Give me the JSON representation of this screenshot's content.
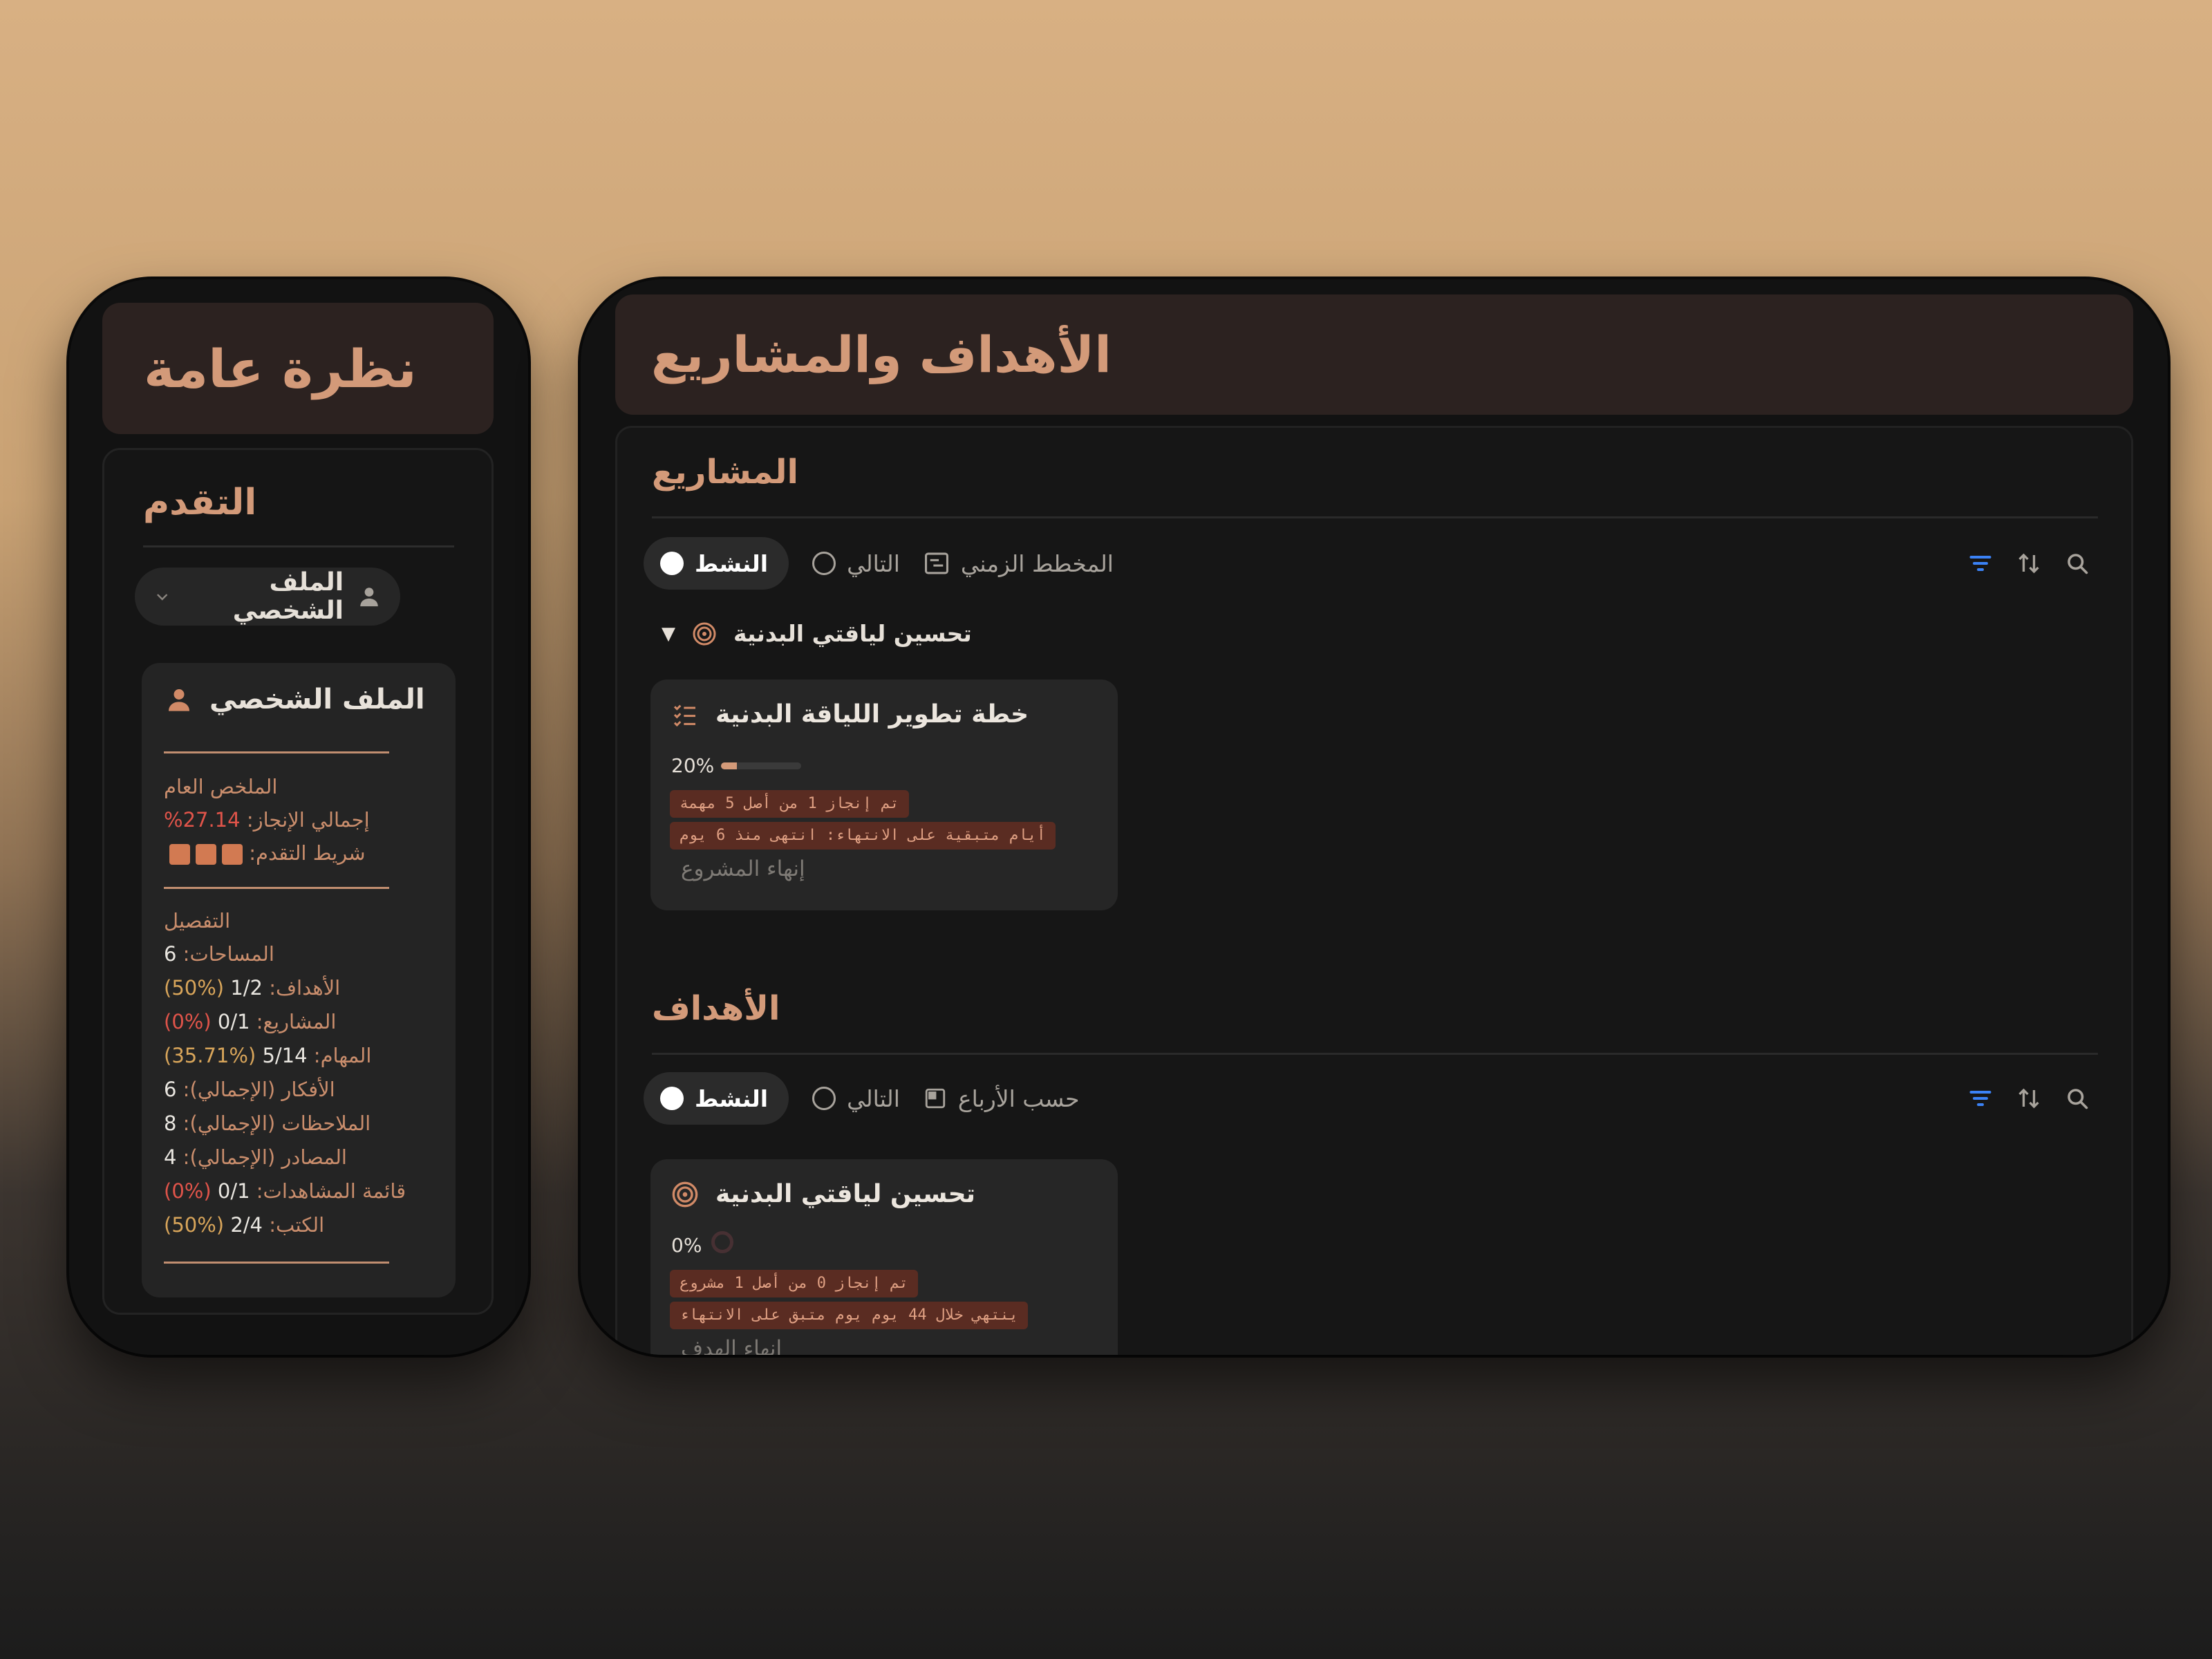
{
  "left_panel": {
    "title": "نظرة عامة",
    "progress": {
      "title": "التقدم",
      "profile_select": {
        "label": "الملف الشخصي",
        "icon": "person-icon"
      },
      "card": {
        "title": "الملف الشخصي",
        "summary_heading": "الملخص العام",
        "total_label": "إجمالي الإنجاز:",
        "total_value": "27.14%",
        "bar_label": "شريط التقدم:",
        "bar_blocks": 3,
        "detail_heading": "التفصيل",
        "details": [
          {
            "label": "المساحات:",
            "value": "6",
            "extra": ""
          },
          {
            "label": "الأهداف:",
            "value": "1/2",
            "extra": "(%50)"
          },
          {
            "label": "المشاريع:",
            "value": "0/1",
            "extra": "(%0)"
          },
          {
            "label": "المهام:",
            "value": "5/14",
            "extra": "(%35.71)"
          },
          {
            "label": "الأفكار (الإجمالي):",
            "value": "6",
            "extra": ""
          },
          {
            "label": "الملاحظات (الإجمالي):",
            "value": "8",
            "extra": ""
          },
          {
            "label": "المصادر (الإجمالي):",
            "value": "4",
            "extra": ""
          },
          {
            "label": "قائمة المشاهدات:",
            "value": "0/1",
            "extra": "(%0)"
          },
          {
            "label": "الكتب:",
            "value": "2/4",
            "extra": "(%50)"
          }
        ]
      }
    }
  },
  "right_panel": {
    "title": "الأهداف والمشاريع",
    "projects": {
      "title": "المشاريع",
      "tabs": {
        "active": "النشط",
        "next": "التالي",
        "timeline": "المخطط الزمني"
      },
      "group": {
        "label": "تحسين لياقتي البدنية",
        "collapsed": false
      },
      "card": {
        "title": "خطة تطوير اللياقة البدنية",
        "progress_label": "20%",
        "progress": 0.2,
        "chip1": "تم إنجاز 1 من أصل 5 مهمة",
        "chip2": "أيام متبقية على الانتهاء: انتهى منذ 6 يوم",
        "finish_label": "إنهاء المشروع"
      }
    },
    "goals": {
      "title": "الأهداف",
      "tabs": {
        "active": "النشط",
        "next": "التالي",
        "quarters": "حسب الأرباع"
      },
      "card": {
        "title": "تحسين لياقتي البدنية",
        "progress_label": "0%",
        "progress": 0,
        "chip1": "تم إنجاز 0 من أصل 1 مشروع",
        "chip2": "ينتهي خلال 44 يوم يوم متبق على الانتهاء",
        "finish_label": "إنهاء الهدف"
      }
    },
    "colors": {
      "accent": "#d39a79",
      "filter_icon": "#3b82f6",
      "chip_bg": "#5a2c22",
      "danger": "#e0544a",
      "warning": "#d8a55a"
    }
  }
}
